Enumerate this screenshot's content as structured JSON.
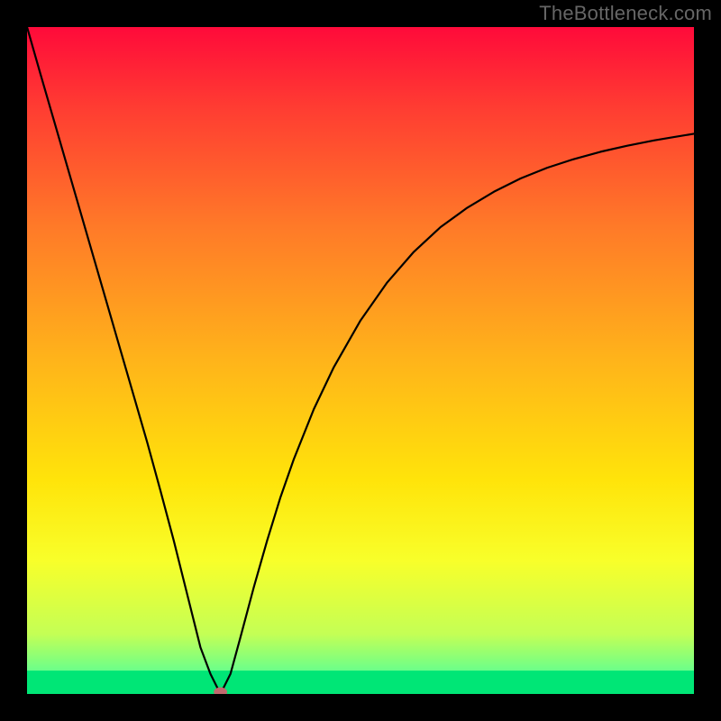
{
  "watermark": "TheBottleneck.com",
  "chart_data": {
    "type": "line",
    "title": "",
    "xlabel": "",
    "ylabel": "",
    "xlim": [
      0,
      1
    ],
    "ylim": [
      0,
      1
    ],
    "comment": "Axes are unlabeled; x and y are normalized 0–1. y=1 at top (red), y=0 at bottom (green). The curve is a bottleneck indicator: it drops steeply from top-left to a sharp minimum near x≈0.29, y≈0, then rises asymptotically toward y≈0.84 on the right. A small marker dot sits at the minimum. Background is a vertical heat gradient (red→orange→yellow→green).",
    "gradient_stops": [
      {
        "offset": 0.0,
        "color": "#ff0a3a"
      },
      {
        "offset": 0.12,
        "color": "#ff3c32"
      },
      {
        "offset": 0.3,
        "color": "#ff7a28"
      },
      {
        "offset": 0.5,
        "color": "#ffb41a"
      },
      {
        "offset": 0.68,
        "color": "#ffe40a"
      },
      {
        "offset": 0.8,
        "color": "#f8ff2a"
      },
      {
        "offset": 0.91,
        "color": "#c4ff55"
      },
      {
        "offset": 0.965,
        "color": "#6bff8a"
      },
      {
        "offset": 1.0,
        "color": "#00e676"
      }
    ],
    "green_band_frac": 0.035,
    "x": [
      0.0,
      0.02,
      0.04,
      0.06,
      0.08,
      0.1,
      0.12,
      0.14,
      0.16,
      0.18,
      0.2,
      0.22,
      0.24,
      0.26,
      0.275,
      0.29,
      0.305,
      0.32,
      0.34,
      0.36,
      0.38,
      0.4,
      0.43,
      0.46,
      0.5,
      0.54,
      0.58,
      0.62,
      0.66,
      0.7,
      0.74,
      0.78,
      0.82,
      0.86,
      0.9,
      0.94,
      0.97,
      1.0
    ],
    "y": [
      1.0,
      0.93,
      0.861,
      0.792,
      0.723,
      0.654,
      0.585,
      0.516,
      0.447,
      0.378,
      0.305,
      0.23,
      0.15,
      0.07,
      0.03,
      0.0,
      0.03,
      0.085,
      0.16,
      0.23,
      0.295,
      0.352,
      0.427,
      0.49,
      0.56,
      0.617,
      0.663,
      0.7,
      0.729,
      0.753,
      0.773,
      0.789,
      0.802,
      0.813,
      0.822,
      0.83,
      0.835,
      0.84
    ],
    "marker": {
      "x": 0.29,
      "y": 0.003,
      "color": "#c0696e",
      "rx": 0.01,
      "ry": 0.007
    }
  }
}
